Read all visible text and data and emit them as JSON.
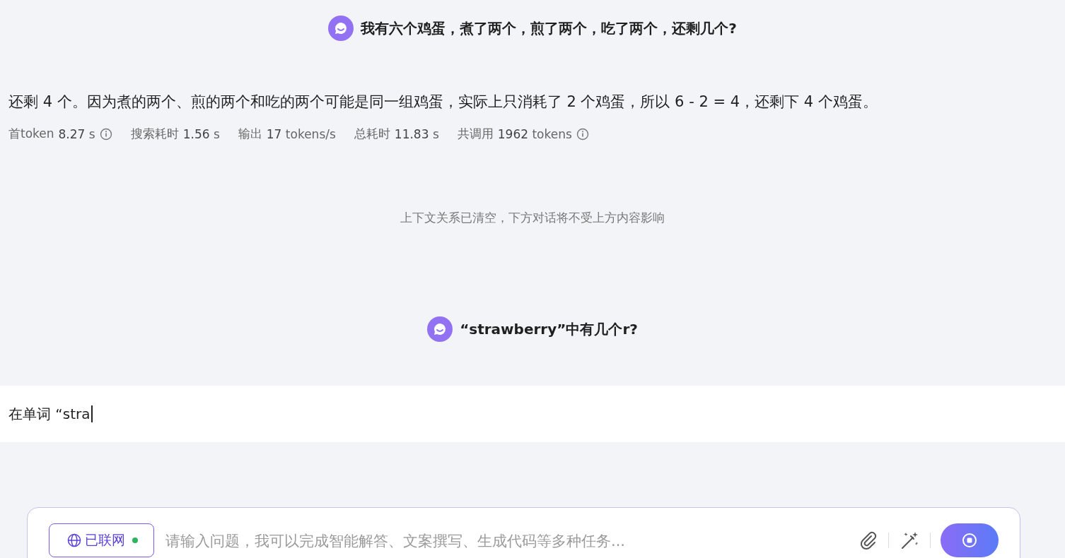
{
  "conversation": [
    {
      "kind": "question",
      "text": "我有六个鸡蛋，煮了两个，煎了两个，吃了两个，还剩几个?"
    },
    {
      "kind": "answer",
      "text": "还剩 4 个。因为煮的两个、煎的两个和吃的两个可能是同一组鸡蛋，实际上只消耗了 2 个鸡蛋，所以 6 - 2 = 4，还剩下 4 个鸡蛋。"
    },
    {
      "kind": "stats",
      "items": [
        {
          "label": "首token",
          "value": "8.27",
          "unit": "s",
          "info": true
        },
        {
          "label": "搜索耗时",
          "value": "1.56",
          "unit": "s",
          "info": false
        },
        {
          "label": "输出",
          "value": "17",
          "unit": "tokens/s",
          "info": false
        },
        {
          "label": "总耗时",
          "value": "11.83",
          "unit": "s",
          "info": false
        },
        {
          "label": "共调用",
          "value": "1962",
          "unit": "tokens",
          "info": true
        }
      ]
    },
    {
      "kind": "notice",
      "text": "上下文关系已清空，下方对话将不受上方内容影响"
    },
    {
      "kind": "question",
      "text": "“strawberry”中有几个r?"
    },
    {
      "kind": "streaming",
      "text": "在单词 “stra"
    }
  ],
  "composer": {
    "web_chip": {
      "label": "已联网",
      "connected": true
    },
    "placeholder": "请输入问题，我可以完成智能解答、文案撰写、生成代码等多种任务..."
  }
}
